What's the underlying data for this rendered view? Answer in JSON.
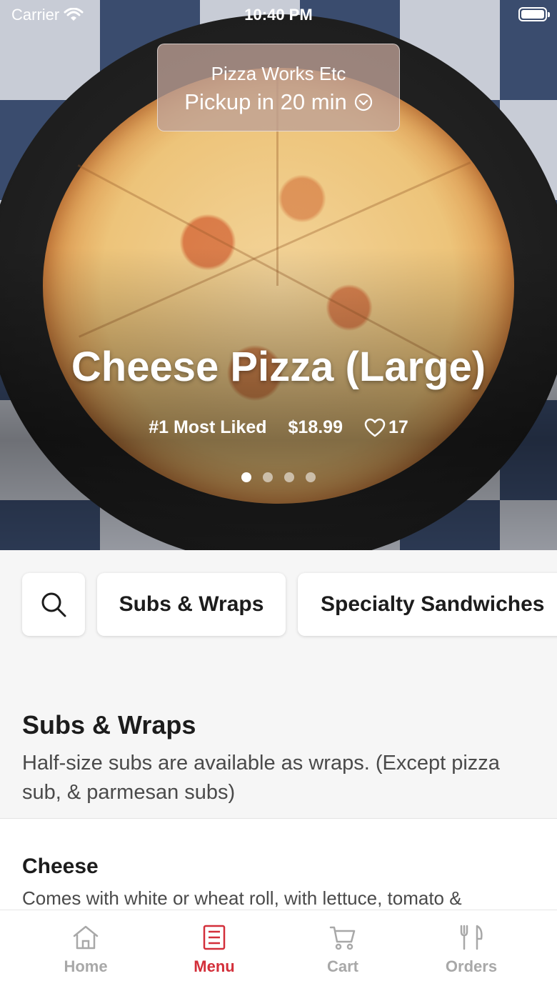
{
  "status_bar": {
    "carrier": "Carrier",
    "time": "10:40 PM"
  },
  "pickup": {
    "store_name": "Pizza Works Etc",
    "label": "Pickup in 20 min"
  },
  "featured": {
    "title": "Cheese Pizza (Large)",
    "rank": "#1 Most Liked",
    "price": "$18.99",
    "likes": "17",
    "slides_total": 4,
    "active_slide": 1
  },
  "categories": [
    "Subs & Wraps",
    "Specialty Sandwiches"
  ],
  "section": {
    "title": "Subs & Wraps",
    "description": "Half-size subs are available as wraps. (Except pizza sub, & parmesan subs)"
  },
  "menu_item": {
    "name": "Cheese",
    "description": "Comes with white or wheat roll, with lettuce, tomato &"
  },
  "tabs": [
    {
      "label": "Home",
      "icon": "home-icon",
      "active": false
    },
    {
      "label": "Menu",
      "icon": "menu-icon",
      "active": true
    },
    {
      "label": "Cart",
      "icon": "cart-icon",
      "active": false
    },
    {
      "label": "Orders",
      "icon": "orders-icon",
      "active": false
    }
  ],
  "colors": {
    "accent": "#d32f3a",
    "inactive": "#a8a8a8"
  }
}
